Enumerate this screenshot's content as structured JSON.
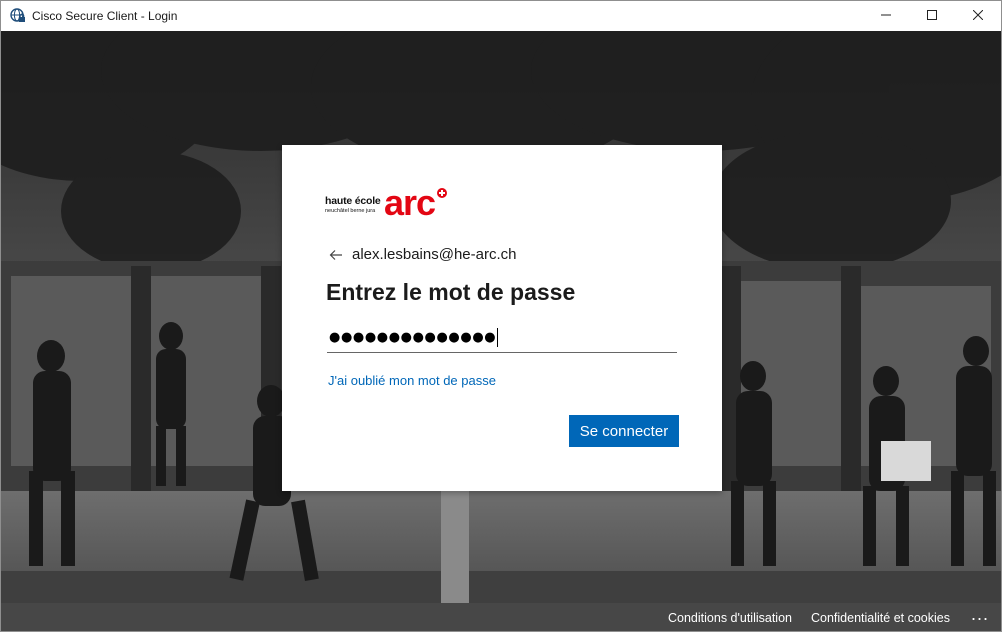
{
  "window": {
    "title": "Cisco Secure Client - Login",
    "app_icon": "globe-lock-icon",
    "controls": [
      "minimize-icon",
      "maximize-icon",
      "close-icon"
    ]
  },
  "signin": {
    "logo": {
      "line1": "haute école",
      "line2": "neuchâtel berne jura",
      "wordmark": "arc"
    },
    "identity": "alex.lesbains@he-arc.ch",
    "heading": "Entrez le mot de passe",
    "password_masked": "●●●●●●●●●●●●●●",
    "forgot_link": "J'ai oublié mon mot de passe",
    "submit_label": "Se connecter"
  },
  "footer": {
    "terms": "Conditions d'utilisation",
    "privacy": "Confidentialité et cookies",
    "more": "..."
  },
  "colors": {
    "accent": "#0067b8",
    "brand_red": "#e30613",
    "footer_bg": "#000000"
  }
}
